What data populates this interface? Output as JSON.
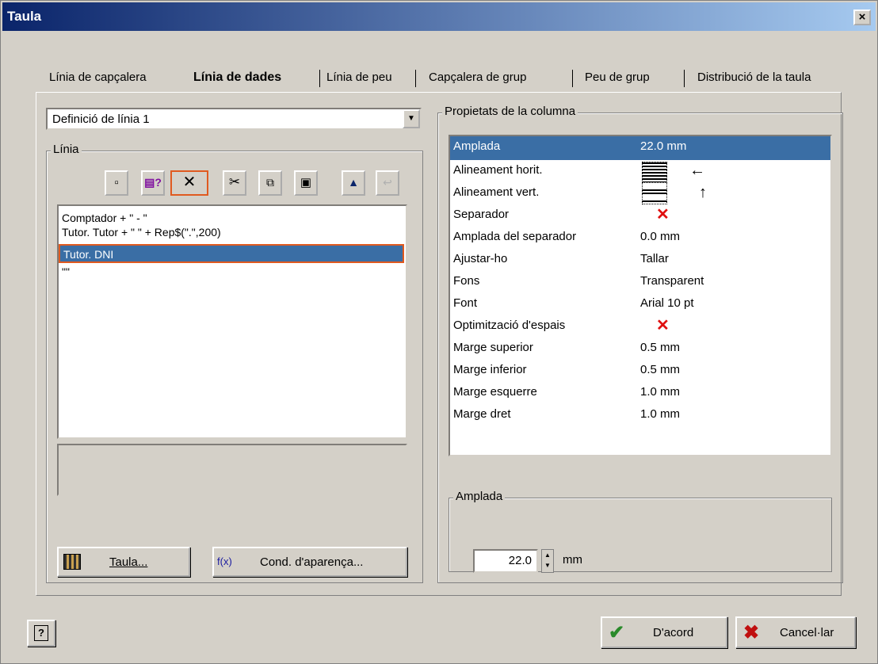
{
  "window": {
    "title": "Taula",
    "close_glyph": "×"
  },
  "tabs": [
    {
      "label": "Línia de capçalera",
      "active": false
    },
    {
      "label": "Línia de dades",
      "active": true
    },
    {
      "label": "Línia de peu",
      "active": false
    },
    {
      "label": "Capçalera de grup",
      "active": false
    },
    {
      "label": "Peu de grup",
      "active": false
    },
    {
      "label": "Distribució de la taula",
      "active": false
    }
  ],
  "line_definition": {
    "selected": "Definició de línia 1"
  },
  "line_group": {
    "legend": "Línia",
    "toolbar_icons": [
      "new-icon",
      "field-help-icon",
      "delete-icon",
      "cut-icon",
      "copy-icon",
      "paste-icon",
      "move-up-icon",
      "move-down-icon"
    ],
    "items": [
      {
        "text": "Comptador + \" - \"",
        "selected": false
      },
      {
        "text": "Tutor. Tutor + \" \" + Rep$(\".\",200)",
        "selected": false
      },
      {
        "text": "Tutor. DNI",
        "selected": true
      },
      {
        "text": "\"\"",
        "selected": false
      }
    ]
  },
  "buttons": {
    "table_label": "Taula...",
    "table_accel": "T",
    "cond_label": "Cond. d'aparença...",
    "cond_accel": "C",
    "fx_label": "f(x)",
    "ok_label": "D'acord",
    "cancel_label": "Cancel·lar",
    "help_glyph": "?"
  },
  "column_properties": {
    "legend": "Propietats de la columna",
    "rows": [
      {
        "name": "Amplada",
        "value": "22.0 mm",
        "selected": true
      },
      {
        "name": "Alineament horit.",
        "value": "←",
        "icon": "align-horizontal-icon"
      },
      {
        "name": "Alineament vert.",
        "value": "↑",
        "icon": "align-vertical-icon"
      },
      {
        "name": "Separador",
        "value": "✕",
        "icon": "red-x-icon"
      },
      {
        "name": "Amplada del separador",
        "value": "0.0 mm"
      },
      {
        "name": "Ajustar-ho",
        "value": "Tallar"
      },
      {
        "name": "Fons",
        "value": "Transparent"
      },
      {
        "name": "Font",
        "value": "Arial 10 pt"
      },
      {
        "name": "Optimització d'espais",
        "value": "✕",
        "icon": "red-x-icon"
      },
      {
        "name": "Marge superior",
        "value": "0.5 mm"
      },
      {
        "name": "Marge inferior",
        "value": "0.5 mm"
      },
      {
        "name": "Marge esquerre",
        "value": "1.0 mm"
      },
      {
        "name": "Marge dret",
        "value": "1.0 mm"
      }
    ]
  },
  "width_group": {
    "legend": "Amplada",
    "value": "22.0",
    "unit": "mm"
  },
  "colors": {
    "title_start": "#0a246a",
    "title_end": "#a6caf0",
    "selection": "#3a6ea5",
    "highlight": "#e05a20",
    "red_x": "#e01010",
    "ok_check": "#2a8a2a"
  }
}
